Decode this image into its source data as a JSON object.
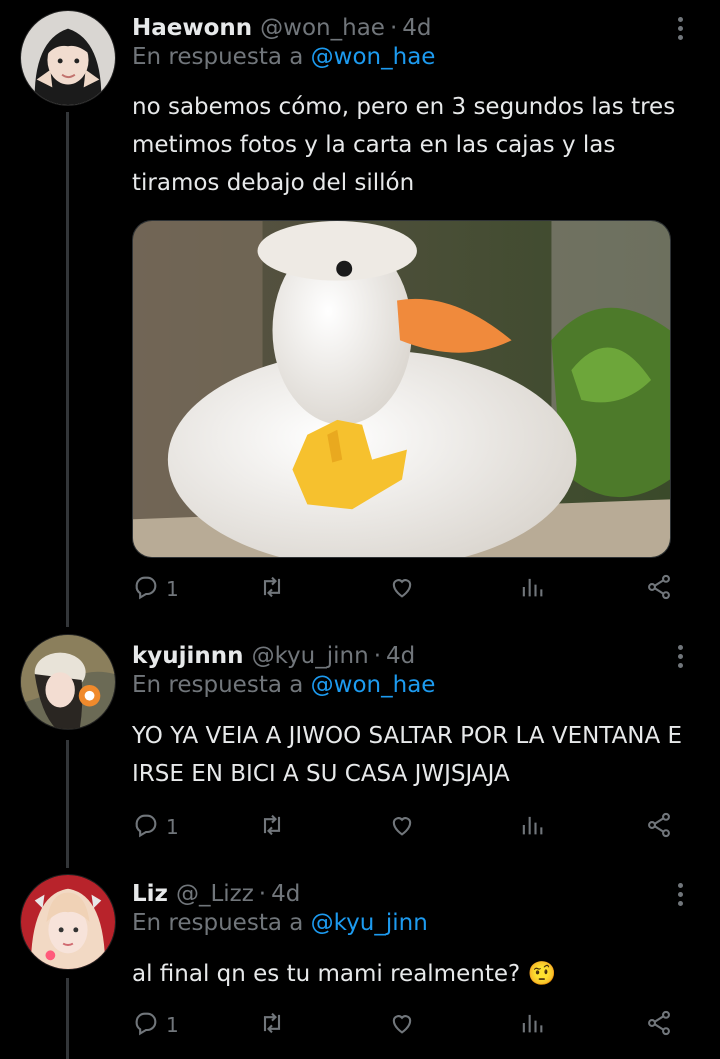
{
  "tweets": [
    {
      "name": "Haewonn",
      "handle": "@won_hae",
      "time": "4d",
      "replying_label": "En respuesta a",
      "replying_to": "@won_hae",
      "text_lines": [
        "no sabemos cómo, pero en 3 segundos las tres",
        "metimos fotos y la carta en las cajas y las",
        "tiramos debajo del sillón"
      ],
      "has_media": true,
      "replies": "1"
    },
    {
      "name": "kyujinnn",
      "handle": "@kyu_jinn",
      "time": "4d",
      "replying_label": "En respuesta a",
      "replying_to": "@won_hae",
      "text_lines": [
        "YO YA VEIA A JIWOO SALTAR POR LA VENTANA E",
        "IRSE EN BICI A SU CASA JWJSJAJA"
      ],
      "has_media": false,
      "replies": "1"
    },
    {
      "name": "Liz",
      "handle": "@_Lizz",
      "time": "4d",
      "replying_label": "En respuesta a",
      "replying_to": "@kyu_jinn",
      "text_lines": [
        "al final qn es tu mami realmente? 🤨"
      ],
      "has_media": false,
      "replies": "1"
    }
  ],
  "separator": "·",
  "icons": [
    "reply-icon",
    "retweet-icon",
    "like-icon",
    "views-icon",
    "share-icon",
    "more-options-icon"
  ],
  "colors": {
    "background": "#000000",
    "text": "#e7e9ea",
    "muted": "#71767b",
    "link": "#1d9bf0"
  }
}
